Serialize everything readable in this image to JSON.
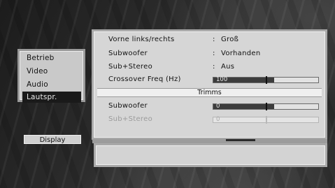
{
  "menu": {
    "items": [
      {
        "label": "Betrieb"
      },
      {
        "label": "Video"
      },
      {
        "label": "Audio"
      },
      {
        "label": "Lautspr."
      }
    ],
    "selected": "Lautspr."
  },
  "display_button": {
    "label": "Display"
  },
  "settings": {
    "separator": ":",
    "front_lr": {
      "label": "Vorne links/rechts",
      "value": "Groß"
    },
    "subwoofer": {
      "label": "Subwoofer",
      "value": "Vorhanden"
    },
    "sub_stereo": {
      "label": "Sub+Stereo",
      "value": "Aus"
    },
    "crossover": {
      "label": "Crossover Freq (Hz)",
      "value": "100"
    }
  },
  "trimms": {
    "header": "Trimms",
    "subwoofer": {
      "label": "Subwoofer",
      "value": "0"
    },
    "sub_stereo": {
      "label": "Sub+Stereo",
      "value": "0",
      "disabled": true
    }
  },
  "colors": {
    "panel": "#d6d6d6",
    "selected_bg": "#1a1a1a",
    "selected_text": "#eaeaea",
    "slider_fill": "#3c3c3c"
  }
}
